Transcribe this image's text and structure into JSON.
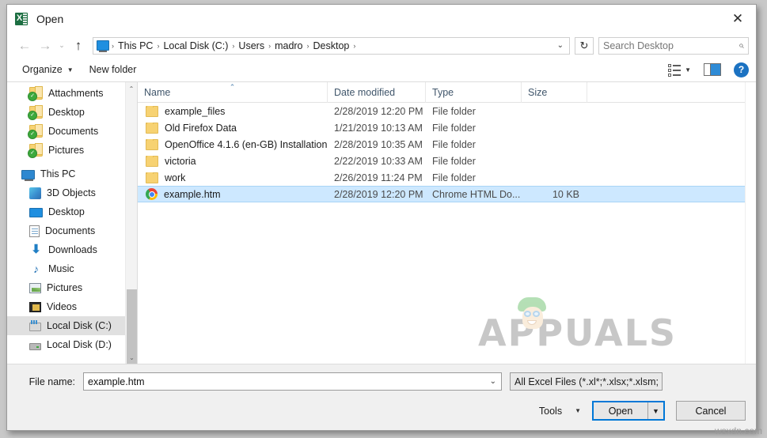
{
  "window": {
    "title": "Open",
    "app_icon": "excel-icon",
    "close_label": "✕"
  },
  "nav": {
    "back_icon": "←",
    "forward_icon": "→",
    "history_icon": "⌄",
    "up_icon": "↑",
    "refresh_icon": "↻",
    "dropdown_icon": "⌄",
    "breadcrumbs": [
      "This PC",
      "Local Disk (C:)",
      "Users",
      "madro",
      "Desktop"
    ],
    "separator": "›"
  },
  "search": {
    "placeholder": "Search Desktop",
    "icon": "search-icon",
    "glyph": "⌕"
  },
  "toolbar": {
    "organize_label": "Organize",
    "new_folder_label": "New folder",
    "caret": "▼",
    "view_icon": "view-options-icon",
    "preview_icon": "preview-pane-icon",
    "help_label": "?"
  },
  "sidebar": {
    "items": [
      {
        "label": "Attachments",
        "icon": "folder-sync-icon",
        "indent": 1,
        "selected": false
      },
      {
        "label": "Desktop",
        "icon": "folder-sync-icon",
        "indent": 1,
        "selected": false
      },
      {
        "label": "Documents",
        "icon": "folder-sync-icon",
        "indent": 1,
        "selected": false
      },
      {
        "label": "Pictures",
        "icon": "folder-sync-icon",
        "indent": 1,
        "selected": false
      },
      {
        "label": "This PC",
        "icon": "monitor-icon",
        "indent": 0,
        "selected": false
      },
      {
        "label": "3D Objects",
        "icon": "3d-objects-icon",
        "indent": 1,
        "selected": false
      },
      {
        "label": "Desktop",
        "icon": "desktop-icon",
        "indent": 1,
        "selected": false
      },
      {
        "label": "Documents",
        "icon": "documents-icon",
        "indent": 1,
        "selected": false
      },
      {
        "label": "Downloads",
        "icon": "downloads-icon",
        "indent": 1,
        "selected": false
      },
      {
        "label": "Music",
        "icon": "music-icon",
        "indent": 1,
        "selected": false
      },
      {
        "label": "Pictures",
        "icon": "pictures-icon",
        "indent": 1,
        "selected": false
      },
      {
        "label": "Videos",
        "icon": "videos-icon",
        "indent": 1,
        "selected": false
      },
      {
        "label": "Local Disk (C:)",
        "icon": "disk-c-icon",
        "indent": 1,
        "selected": true
      },
      {
        "label": "Local Disk (D:)",
        "icon": "disk-d-icon",
        "indent": 1,
        "selected": false
      }
    ],
    "scroll_up_icon": "⌃",
    "scroll_down_icon": "⌄"
  },
  "filelist": {
    "columns": [
      {
        "label": "Name",
        "sorted": true,
        "sort_arrow": "⌃"
      },
      {
        "label": "Date modified",
        "sorted": false,
        "sort_arrow": ""
      },
      {
        "label": "Type",
        "sorted": false,
        "sort_arrow": ""
      },
      {
        "label": "Size",
        "sorted": false,
        "sort_arrow": ""
      }
    ],
    "rows": [
      {
        "name": "example_files",
        "date": "2/28/2019 12:20 PM",
        "type": "File folder",
        "size": "",
        "icon": "folder-icon",
        "selected": false
      },
      {
        "name": "Old Firefox Data",
        "date": "1/21/2019 10:13 AM",
        "type": "File folder",
        "size": "",
        "icon": "folder-icon",
        "selected": false
      },
      {
        "name": "OpenOffice 4.1.6 (en-GB) Installation Files",
        "date": "2/28/2019 10:35 AM",
        "type": "File folder",
        "size": "",
        "icon": "folder-icon",
        "selected": false
      },
      {
        "name": "victoria",
        "date": "2/22/2019 10:33 AM",
        "type": "File folder",
        "size": "",
        "icon": "folder-icon",
        "selected": false
      },
      {
        "name": "work",
        "date": "2/26/2019 11:24 PM",
        "type": "File folder",
        "size": "",
        "icon": "folder-icon",
        "selected": false
      },
      {
        "name": "example.htm",
        "date": "2/28/2019 12:20 PM",
        "type": "Chrome HTML Do...",
        "size": "10 KB",
        "icon": "chrome-icon",
        "selected": true
      }
    ]
  },
  "watermark": {
    "text": "APPUALS",
    "corner_text": "wsxdn.com"
  },
  "footer": {
    "filename_label": "File name:",
    "filename_value": "example.htm",
    "filename_dropdown_icon": "⌄",
    "filter_value": "All Excel Files (*.xl*;*.xlsx;*.xlsm;",
    "filter_dropdown_icon": "⌄",
    "tools_label": "Tools",
    "tools_caret": "▼",
    "open_label": "Open",
    "open_caret": "▼",
    "cancel_label": "Cancel"
  },
  "colors": {
    "accent": "#0078d7",
    "selection": "#cde8ff",
    "folder": "#f7d272",
    "excel_green": "#1d6f42"
  }
}
